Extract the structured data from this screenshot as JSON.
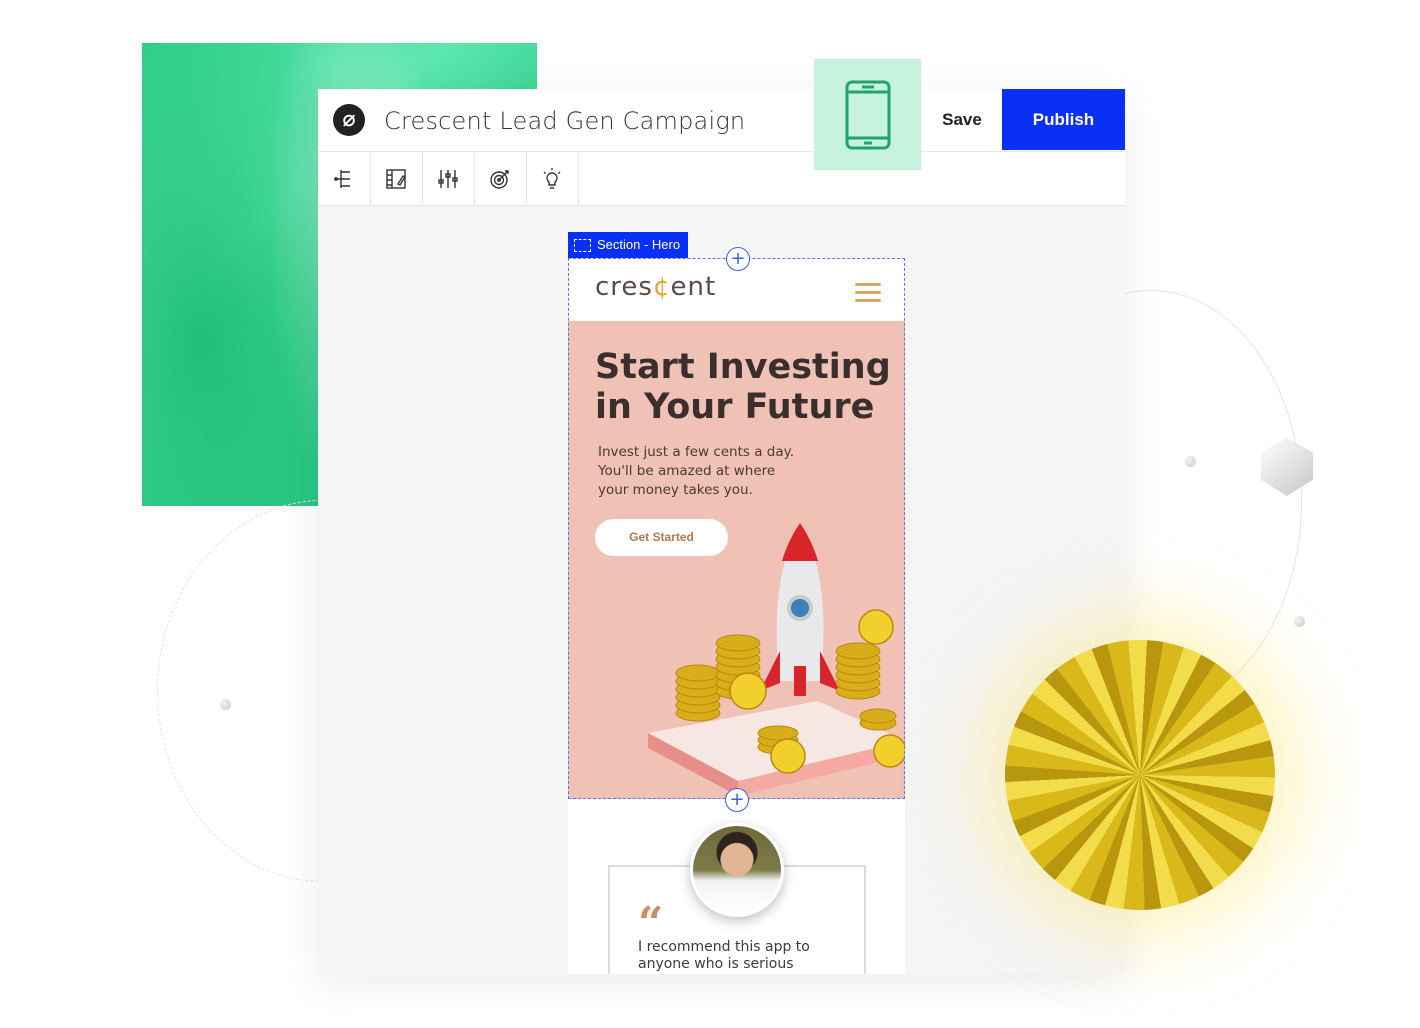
{
  "app": {
    "title": "Crescent  Lead Gen Campaign",
    "save_label": "Save",
    "publish_label": "Publish",
    "accent_color": "#0a2ff5"
  },
  "toolbar": {
    "tools": [
      {
        "icon": "sitemap-icon"
      },
      {
        "icon": "style-guide-icon"
      },
      {
        "icon": "sliders-icon"
      },
      {
        "icon": "target-icon"
      },
      {
        "icon": "lightbulb-icon"
      }
    ]
  },
  "device_toggle": {
    "icon": "mobile-phone-icon"
  },
  "canvas": {
    "section_label": "Section - Hero",
    "site": {
      "brand_prefix": "cres",
      "brand_accent": "¢",
      "brand_suffix": "ent",
      "hero_title": "Start Investing in Your Future",
      "hero_text": "Invest just a few cents a day. You'll be amazed at where your money takes you.",
      "cta_label": "Get Started",
      "quote_mark": "“",
      "testimonial": "I recommend this app to anyone who is serious"
    }
  }
}
